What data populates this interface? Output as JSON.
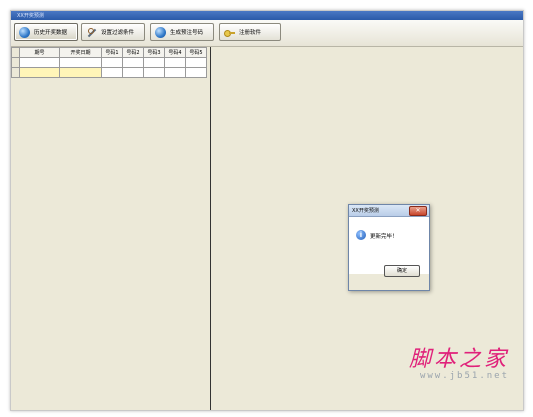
{
  "window": {
    "title": "XX开奖预测"
  },
  "toolbar": {
    "buttons": [
      {
        "label": "历史开奖数据",
        "icon": "globe-icon"
      },
      {
        "label": "设置过滤条件",
        "icon": "tools-icon"
      },
      {
        "label": "生成预注号码",
        "icon": "globe-icon"
      },
      {
        "label": "注册软件",
        "icon": "key-icon"
      }
    ]
  },
  "grid": {
    "columns": [
      "期号",
      "开奖日期",
      "号码1",
      "号码2",
      "号码3",
      "号码4",
      "号码5"
    ]
  },
  "dialog": {
    "title": "XX开奖预测",
    "message": "更新完毕！",
    "ok_label": "确定",
    "close_label": "✕"
  },
  "watermark": {
    "text": "脚本之家",
    "url": "www.jb51.net"
  }
}
